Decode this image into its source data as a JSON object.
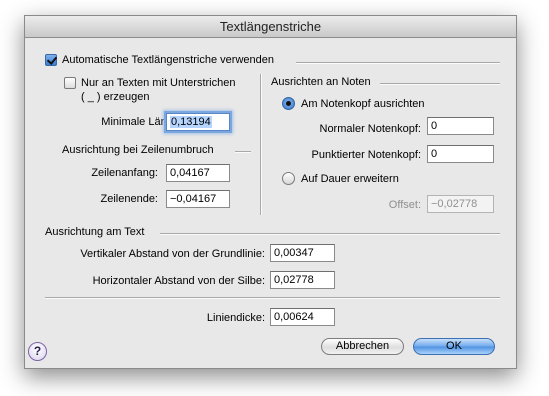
{
  "window": {
    "title": "Textlängenstriche"
  },
  "auto_checkbox": {
    "label": "Automatische Textlängenstriche verwenden",
    "checked": true
  },
  "underline_checkbox": {
    "label_line1": "Nur an Texten mit Unterstrichen",
    "label_line2": "( _ ) erzeugen",
    "checked": false
  },
  "min_length": {
    "label": "Minimale Länge:",
    "value": "0,13194"
  },
  "line_break": {
    "header": "Ausrichtung bei Zeilenumbruch",
    "start_label": "Zeilenanfang:",
    "start_value": "0,04167",
    "end_label": "Zeilenende:",
    "end_value": "−0,04167"
  },
  "notes": {
    "header": "Ausrichten an Noten",
    "radio_notehead": {
      "label": "Am Notenkopf ausrichten",
      "selected": true
    },
    "normal_label": "Normaler Notenkopf:",
    "normal_value": "0",
    "dotted_label": "Punktierter Notenkopf:",
    "dotted_value": "0",
    "radio_duration": {
      "label": "Auf Dauer erweitern",
      "selected": false
    },
    "offset_label": "Offset:",
    "offset_value": "−0,02778"
  },
  "text_alignment": {
    "header": "Ausrichtung am Text",
    "vertical_label": "Vertikaler Abstand von der Grundlinie:",
    "vertical_value": "0,00347",
    "horizontal_label": "Horizontaler Abstand von der Silbe:",
    "horizontal_value": "0,02778"
  },
  "line_thickness": {
    "label": "Liniendicke:",
    "value": "0,00624"
  },
  "buttons": {
    "help": "?",
    "cancel": "Abbrechen",
    "ok": "OK"
  }
}
